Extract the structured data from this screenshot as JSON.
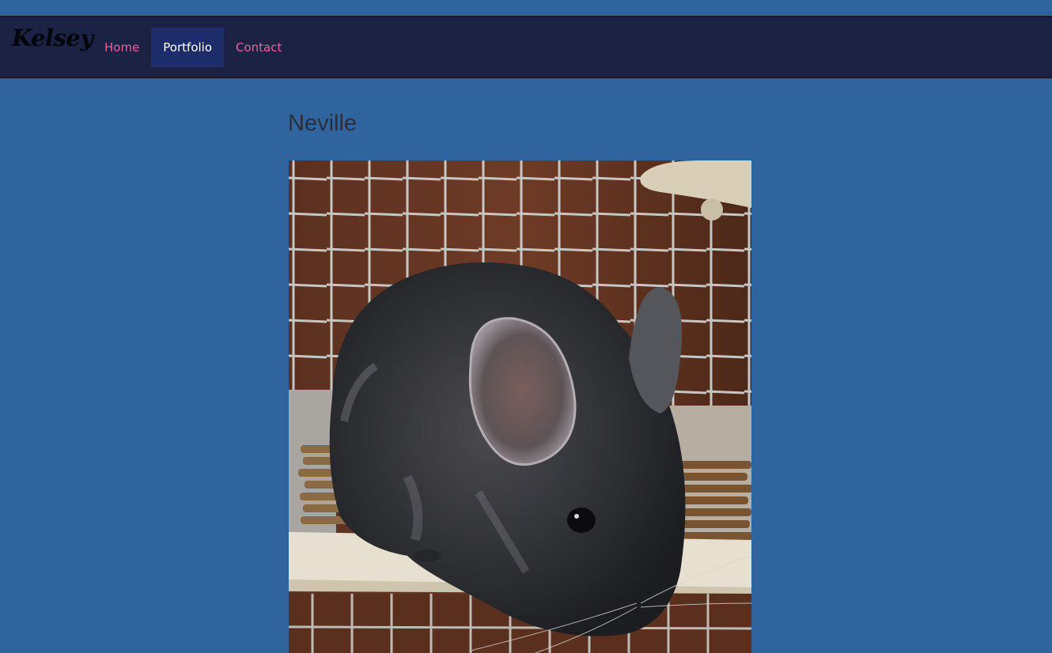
{
  "navbar": {
    "brand": "Kelsey",
    "items": [
      {
        "label": "Home",
        "active": false
      },
      {
        "label": "Portfolio",
        "active": true
      },
      {
        "label": "Contact",
        "active": false
      }
    ]
  },
  "main": {
    "title": "Neville"
  },
  "colors": {
    "page_background": "#2f649f",
    "navbar_background": "#1b2243",
    "nav_link": "#e9619c",
    "nav_active_background": "#1d2d6b",
    "nav_active_text": "#ffffff",
    "title_text": "#2b2f3b"
  }
}
